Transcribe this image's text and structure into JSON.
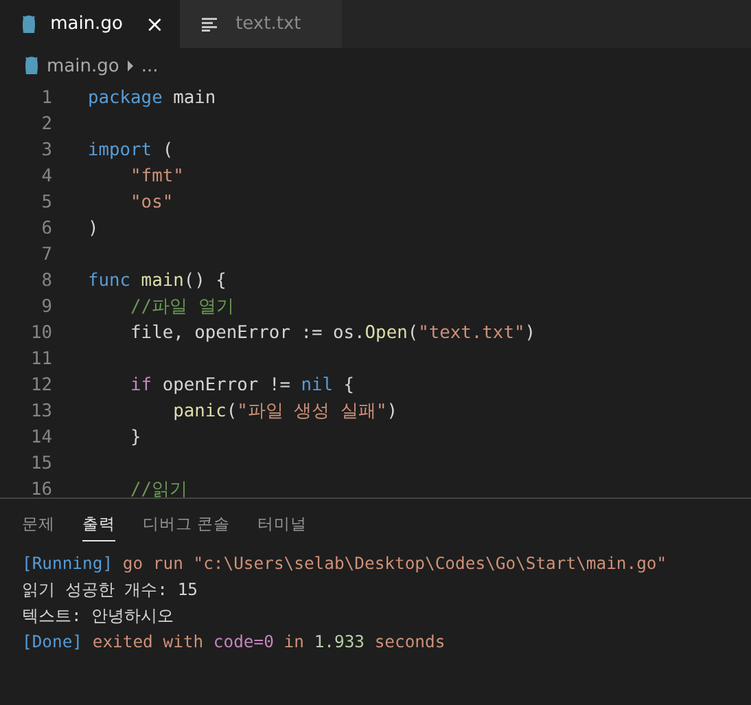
{
  "tabs": [
    {
      "label": "main.go",
      "kind": "go",
      "selected": true,
      "close": "×"
    },
    {
      "label": "text.txt",
      "kind": "text",
      "selected": false
    }
  ],
  "breadcrumb": {
    "file": "main.go",
    "more": "..."
  },
  "editor": {
    "lines": [
      {
        "number": "1",
        "tokens": [
          {
            "text": "package",
            "kind": "kw"
          },
          {
            "text": " main",
            "kind": "plain"
          }
        ]
      },
      {
        "number": "2"
      },
      {
        "number": "3",
        "tokens": [
          {
            "text": "import",
            "kind": "kw"
          },
          {
            "text": " (",
            "kind": "plain"
          }
        ]
      },
      {
        "number": "4",
        "tokens": [
          {
            "text": "    \"fmt\"",
            "kind": "str"
          }
        ]
      },
      {
        "number": "5",
        "tokens": [
          {
            "text": "    \"os\"",
            "kind": "str"
          }
        ]
      },
      {
        "number": "6",
        "tokens": [
          {
            "text": ")",
            "kind": "plain"
          }
        ]
      },
      {
        "number": "7"
      },
      {
        "number": "8",
        "tokens": [
          {
            "text": "func",
            "kind": "kw"
          },
          {
            "text": " main",
            "kind": "fn"
          },
          {
            "text": "() {",
            "kind": "plain"
          }
        ]
      },
      {
        "number": "9",
        "tokens": [
          {
            "text": "    //파일 열기",
            "kind": "com"
          }
        ]
      },
      {
        "number": "10",
        "tokens": [
          {
            "text": "    file, openError := os.",
            "kind": "plain"
          },
          {
            "text": "Open",
            "kind": "fn"
          },
          {
            "text": "(",
            "kind": "plain"
          },
          {
            "text": "\"text.txt\"",
            "kind": "str"
          },
          {
            "text": ")",
            "kind": "plain"
          }
        ]
      },
      {
        "number": "11"
      },
      {
        "number": "12",
        "tokens": [
          {
            "text": "    if",
            "kind": "ctl"
          },
          {
            "text": " openError != ",
            "kind": "plain"
          },
          {
            "text": "nil",
            "kind": "kw"
          },
          {
            "text": " {",
            "kind": "plain"
          }
        ]
      },
      {
        "number": "13",
        "tokens": [
          {
            "text": "        panic",
            "kind": "fn"
          },
          {
            "text": "(",
            "kind": "plain"
          },
          {
            "text": "\"파일 생성 실패\"",
            "kind": "str"
          },
          {
            "text": ")",
            "kind": "plain"
          }
        ]
      },
      {
        "number": "14",
        "tokens": [
          {
            "text": "    }",
            "kind": "plain"
          }
        ]
      },
      {
        "number": "15"
      },
      {
        "number": "16",
        "tokens": [
          {
            "text": "    //읽기",
            "kind": "com"
          }
        ]
      }
    ]
  },
  "panel": {
    "tabs": [
      {
        "label": "문제",
        "selected": false
      },
      {
        "label": "출력",
        "selected": true
      },
      {
        "label": "디버그 콘솔",
        "selected": false
      },
      {
        "label": "터미널",
        "selected": false
      }
    ],
    "output": [
      [
        {
          "text": "[Running]",
          "kind": "tag"
        },
        {
          "text": " go run \"c:\\Users\\selab\\Desktop\\Codes\\Go\\Start\\main.go\"",
          "kind": "str"
        }
      ],
      [
        {
          "text": "읽기 성공한 개수: 15",
          "kind": "plain"
        }
      ],
      [
        {
          "text": "텍스트: 안녕하시오",
          "kind": "plain"
        }
      ],
      [
        {
          "text": "[Done]",
          "kind": "tag"
        },
        {
          "text": " exited with ",
          "kind": "str"
        },
        {
          "text": "code=0",
          "kind": "code"
        },
        {
          "text": " in ",
          "kind": "str"
        },
        {
          "text": "1.933",
          "kind": "num"
        },
        {
          "text": " seconds",
          "kind": "str"
        }
      ]
    ]
  }
}
